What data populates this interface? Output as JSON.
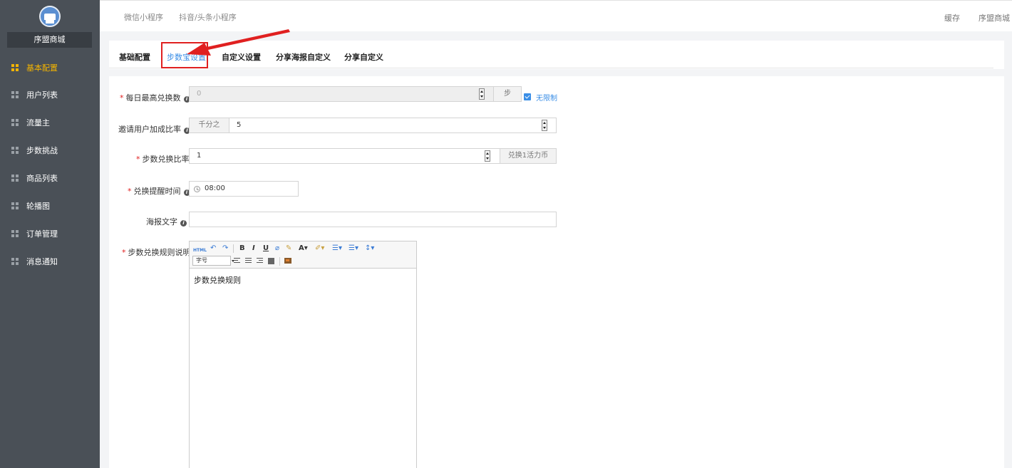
{
  "sidebar": {
    "shop_name": "序盟商城",
    "items": [
      {
        "label": "基本配置",
        "active": true
      },
      {
        "label": "用户列表",
        "active": false
      },
      {
        "label": "流量主",
        "active": false
      },
      {
        "label": "步数挑战",
        "active": false
      },
      {
        "label": "商品列表",
        "active": false
      },
      {
        "label": "轮播图",
        "active": false
      },
      {
        "label": "订单管理",
        "active": false
      },
      {
        "label": "消息通知",
        "active": false
      }
    ]
  },
  "topbar": {
    "links": [
      "微信小程序",
      "抖音/头条小程序"
    ],
    "cache": "缓存",
    "user": "序盟商城"
  },
  "tabs": [
    {
      "label": "基础配置",
      "active": false
    },
    {
      "label": "步数宝设置",
      "active": true
    },
    {
      "label": "自定义设置",
      "active": false
    },
    {
      "label": "分享海报自定义",
      "active": false
    },
    {
      "label": "分享自定义",
      "active": false
    }
  ],
  "form": {
    "daily_max": {
      "label": "每日最高兑换数",
      "value": "0",
      "unit": "步",
      "unlimited_label": "无限制",
      "unlimited_checked": true
    },
    "invite_ratio": {
      "label": "邀请用户加成比率",
      "prefix": "千分之",
      "value": "5"
    },
    "step_ratio": {
      "label": "步数兑换比率",
      "value": "1",
      "suffix": "兑换1活力币"
    },
    "remind_time": {
      "label": "兑换提醒时间",
      "value": "08:00"
    },
    "poster_text": {
      "label": "海报文字",
      "value": ""
    },
    "rules": {
      "label": "步数兑换规则说明",
      "font_select": "字号",
      "content": "步数兑换规则"
    }
  },
  "colors": {
    "accent": "#3a8ee6",
    "sidebar_bg": "#4a5057",
    "active_nav": "#f4b400",
    "annotation": "#e02020"
  }
}
